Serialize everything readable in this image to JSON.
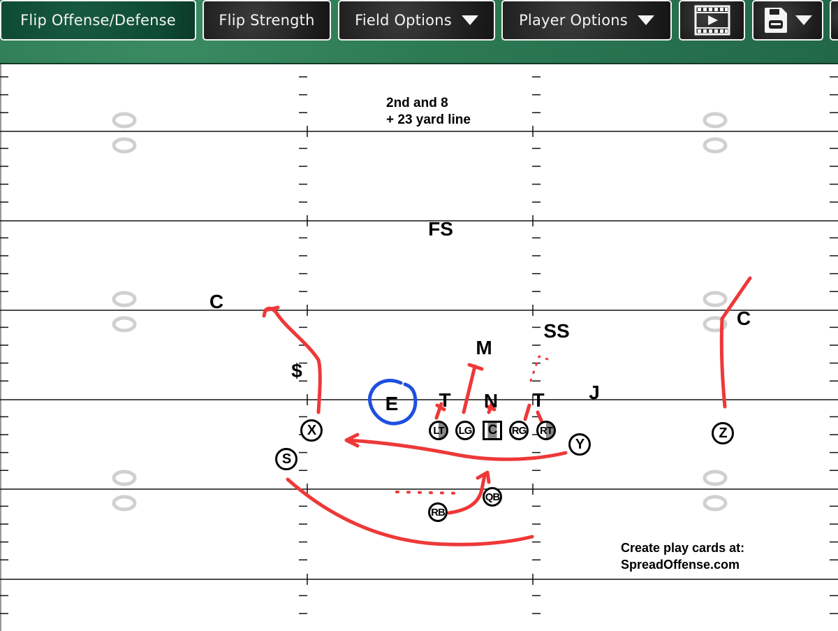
{
  "toolbar": {
    "buttons": [
      {
        "label": "Flip Offense/Defense",
        "active": true
      },
      {
        "label": "Flip Strength"
      },
      {
        "label": "Field Options",
        "dropdown": true
      },
      {
        "label": "Player Options",
        "dropdown": true
      }
    ],
    "icons": {
      "video": "film-play-icon",
      "save": "floppy-save-icon",
      "dropdown": "caret-down-icon"
    }
  },
  "situation": {
    "down_distance": "2nd and 8",
    "field_position": "+ 23 yard line"
  },
  "defense": [
    {
      "id": "fs",
      "label": "FS"
    },
    {
      "id": "c-left",
      "label": "C"
    },
    {
      "id": "c-right",
      "label": "C"
    },
    {
      "id": "ss",
      "label": "SS"
    },
    {
      "id": "m",
      "label": "M"
    },
    {
      "id": "dollar",
      "label": "$"
    },
    {
      "id": "e",
      "label": "E"
    },
    {
      "id": "t-left",
      "label": "T"
    },
    {
      "id": "n",
      "label": "N"
    },
    {
      "id": "t-right",
      "label": "T"
    },
    {
      "id": "j",
      "label": "J"
    }
  ],
  "offense": [
    {
      "id": "x",
      "label": "X"
    },
    {
      "id": "s",
      "label": "S"
    },
    {
      "id": "lt",
      "label": "LT"
    },
    {
      "id": "lg",
      "label": "LG"
    },
    {
      "id": "c",
      "label": "C"
    },
    {
      "id": "rg",
      "label": "RG"
    },
    {
      "id": "rt",
      "label": "RT"
    },
    {
      "id": "y",
      "label": "Y"
    },
    {
      "id": "z",
      "label": "Z"
    },
    {
      "id": "qb",
      "label": "QB"
    },
    {
      "id": "rb",
      "label": "RB"
    }
  ],
  "watermark": {
    "line1": "Create play cards at:",
    "line2": "SpreadOffense.com"
  },
  "colors": {
    "route": "#ee3838",
    "highlight": "#1f4fe0",
    "toolbar_green": "#2c7a54",
    "button_dark": "#1f1f1f"
  }
}
